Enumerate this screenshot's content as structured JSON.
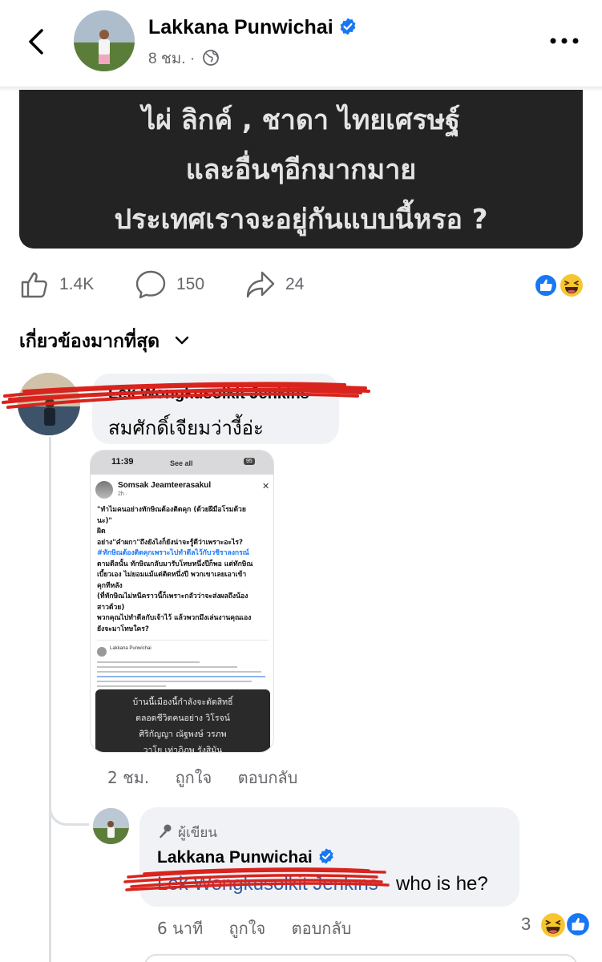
{
  "header": {
    "name": "Lakkana Punwichai",
    "meta": "8 ชม. ·"
  },
  "post_image": {
    "lines": [
      "ไผ่ ลิกค์ , ชาดา ไทยเศรษฐ์",
      "และอื่นๆอีกมากมาย",
      "ประเทศเราจะอยู่กันแบบนี้หรอ ?"
    ]
  },
  "reactions": {
    "likes": "1.4K",
    "comments": "150",
    "shares": "24"
  },
  "filter": {
    "label": "เกี่ยวข้องมากที่สุด"
  },
  "comment1": {
    "name": "Lek Wongkusolkit Jenkins",
    "text": "สมศักดิ์เจียมว่างี้อ่ะ",
    "time": "2 ชม.",
    "like_label": "ถูกใจ",
    "reply_label": "ตอบกลับ",
    "screenshot": {
      "status_time": "11:39",
      "see_all": "See all",
      "battery": "95",
      "author": "Somsak Jeamteerasakul",
      "time": "2h · ",
      "lines": [
        "\"ทำไมคนอย่างทักษิณต้องติดคุก (ด้วยฝีมือโรมด้วย",
        "นะ)\"",
        "ผิด",
        "อย่าง\"คำผกา\"ถึงยังไงก็ยังน่าจะรู้ดีว่าเพราะอะไร?",
        "#ทักษิณต้องติดคุกเพราะไปทำดีลไว้กับวชิราลงกรณ์",
        "ตามดีลนั้น ทักษิณกลับมารับโทษหนึ่งปีก็พอ แต่ทักษิณ",
        "เบี้ยวเอง ไม่ยอมแม้แต่ติดหนึ่งปี พวกเขาเลยเอาเข้า",
        "คุกทีหลัง",
        "(ที่ทักษิณไม่หนีคราวนี้ก็เพราะกลัวว่าจะส่งผลถึงน้อง",
        "สาวด้วย)",
        "พวกคุณไปทำดีลกับเจ้าไว้ แล้วพวกมึงเล่นงานคุณเอง",
        "ยังจะมาโทษใคร?"
      ],
      "sub_name": "Lakkana Punwichai",
      "dark_lines": [
        "บ้านนี้เมืองนี้กำลังจะตัดสิทธิ์",
        "ตลอดชีวิตคนอย่าง วิโรจน์",
        "ศิริกัญญา ณัฐพงษ์ วรภพ",
        "วาโย เท่าภิภพ รังสิมัน"
      ]
    }
  },
  "reply": {
    "author_tag": "ผู้เขียน",
    "name": "Lakkana Punwichai",
    "mention": "Lek Wongkusolkit Jenkins",
    "text": "who is he?",
    "time": "6 นาที",
    "like_label": "ถูกใจ",
    "reply_label": "ตอบกลับ",
    "reaction_count": "3"
  },
  "colors": {
    "facebook_blue": "#1877f2",
    "dark_card": "#232324",
    "bubble": "#f0f2f5",
    "secondary_text": "#65676b",
    "redaction": "#d9231d"
  },
  "icons": [
    "back-arrow-icon",
    "verified-badge-icon",
    "globe-icon",
    "more-icon",
    "like-icon",
    "comment-icon",
    "share-icon",
    "like-reaction-icon",
    "haha-reaction-icon",
    "chevron-down-icon",
    "microphone-icon"
  ]
}
